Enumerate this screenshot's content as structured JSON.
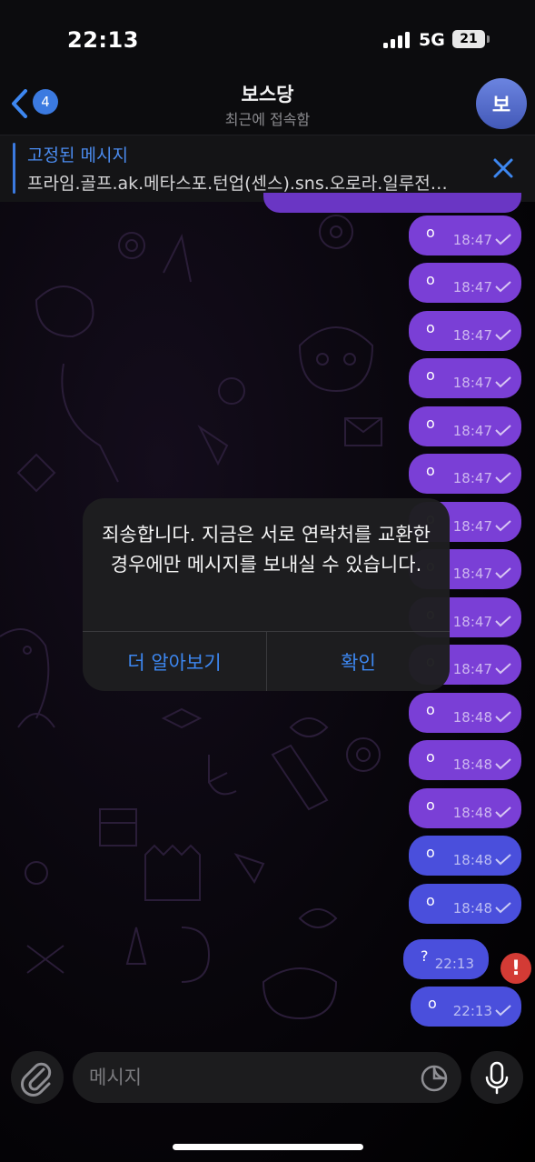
{
  "status": {
    "time": "22:13",
    "network": "5G",
    "battery": "21"
  },
  "header": {
    "back_badge": "4",
    "title": "보스당",
    "subtitle": "최근에 접속함",
    "avatar_initial": "보"
  },
  "pinned": {
    "title": "고정된 메시지",
    "text": "프라임.골프.ak.메타스포.턴업(센스).sns.오로라.일루전…"
  },
  "messages": [
    {
      "text": "o",
      "time": "18:47",
      "status": "read"
    },
    {
      "text": "o",
      "time": "18:47",
      "status": "read"
    },
    {
      "text": "o",
      "time": "18:47",
      "status": "read"
    },
    {
      "text": "o",
      "time": "18:47",
      "status": "read"
    },
    {
      "text": "o",
      "time": "18:47",
      "status": "read"
    },
    {
      "text": "o",
      "time": "18:47",
      "status": "read"
    },
    {
      "text": "o",
      "time": "18:47",
      "status": "read"
    },
    {
      "text": "o",
      "time": "18:47",
      "status": "read"
    },
    {
      "text": "o",
      "time": "18:47",
      "status": "read"
    },
    {
      "text": "o",
      "time": "18:47",
      "status": "read"
    },
    {
      "text": "o",
      "time": "18:48",
      "status": "read"
    },
    {
      "text": "o",
      "time": "18:48",
      "status": "read"
    },
    {
      "text": "o",
      "time": "18:48",
      "status": "read"
    },
    {
      "text": "o",
      "time": "18:48",
      "status": "read"
    },
    {
      "text": "o",
      "time": "18:48",
      "status": "read"
    },
    {
      "text": "?",
      "time": "22:13",
      "status": "failed"
    },
    {
      "text": "o",
      "time": "22:13",
      "status": "read"
    }
  ],
  "alert": {
    "message": "죄송합니다. 지금은 서로 연락처를 교환한 경우에만 메시지를 보내실 수 있습니다.",
    "learn_more": "더 알아보기",
    "ok": "확인"
  },
  "error_mark": "!",
  "composer": {
    "placeholder": "메시지"
  },
  "colors": {
    "accent": "#3d87f0",
    "bubble_purple": "#7a3fd6",
    "bubble_blue": "#4a4fdc",
    "error": "#d33b35"
  }
}
